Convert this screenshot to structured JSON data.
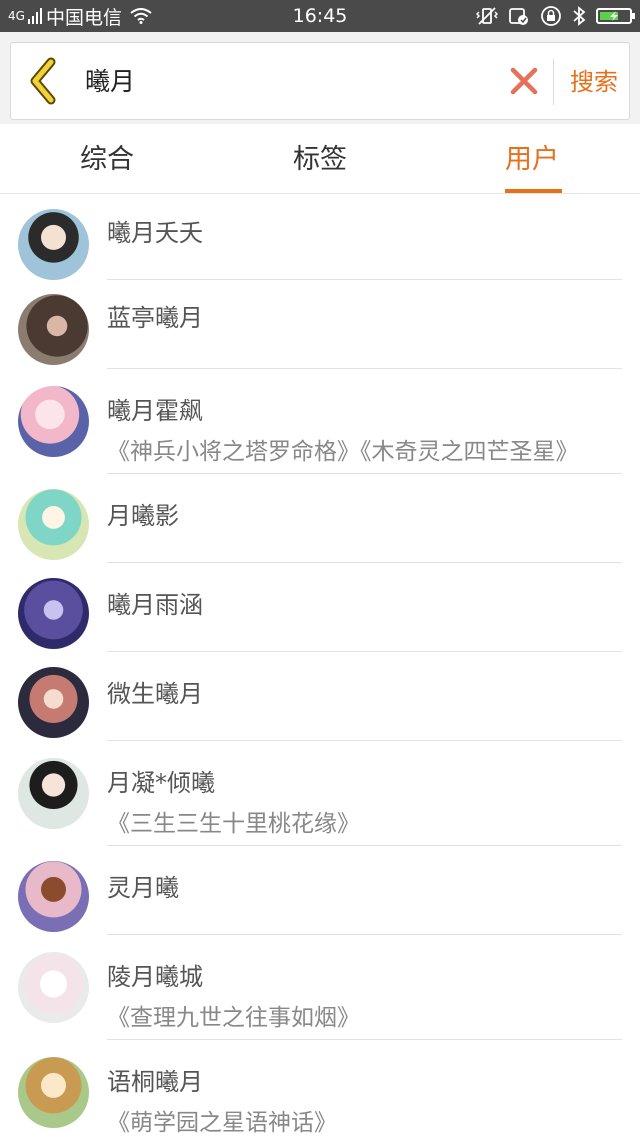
{
  "status_bar": {
    "network": "4G",
    "carrier": "中国电信",
    "time": "16:45"
  },
  "search": {
    "query": "曦月",
    "button_label": "搜索"
  },
  "tabs": [
    {
      "label": "综合",
      "active": false
    },
    {
      "label": "标签",
      "active": false
    },
    {
      "label": "用户",
      "active": true
    }
  ],
  "colors": {
    "accent": "#e8701d",
    "status_bar": "#4a4a4a"
  },
  "users": [
    {
      "name": "曦月夭夭",
      "desc": ""
    },
    {
      "name": "蓝亭曦月",
      "desc": ""
    },
    {
      "name": "曦月霍飙",
      "desc": "《神兵小将之塔罗命格》《木奇灵之四芒圣星》"
    },
    {
      "name": "月曦影",
      "desc": ""
    },
    {
      "name": "曦月雨涵",
      "desc": ""
    },
    {
      "name": "微生曦月",
      "desc": ""
    },
    {
      "name": "月凝*倾曦",
      "desc": "《三生三生十里桃花缘》"
    },
    {
      "name": "灵月曦",
      "desc": ""
    },
    {
      "name": "陵月曦城",
      "desc": "《查理九世之往事如烟》"
    },
    {
      "name": "语桐曦月",
      "desc": "《萌学园之星语神话》"
    }
  ]
}
